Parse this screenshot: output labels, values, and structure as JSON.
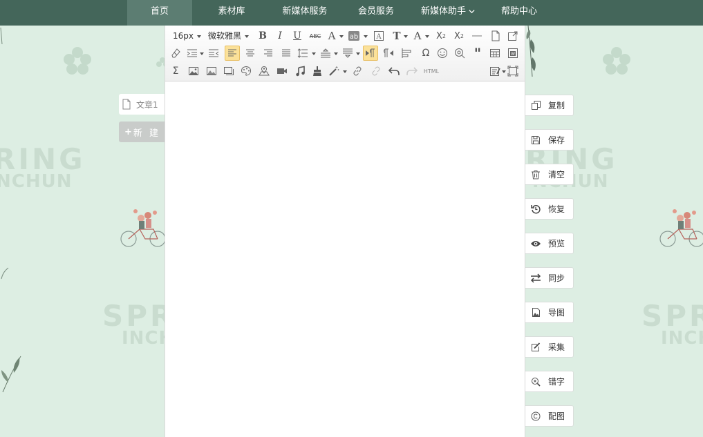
{
  "nav": {
    "items": [
      {
        "label": "首页",
        "active": true
      },
      {
        "label": "素材库"
      },
      {
        "label": "新媒体服务"
      },
      {
        "label": "会员服务"
      },
      {
        "label": "新媒体助手"
      },
      {
        "label": "帮助中心"
      }
    ],
    "bg_color": "#44665a",
    "active_color": "#5c7d72"
  },
  "documents": {
    "tabs": [
      {
        "label": "文章1"
      }
    ],
    "new_button": "新 建"
  },
  "toolbar": {
    "font_size": "16px",
    "font_family": "微软雅黑",
    "html_label": "HTML"
  },
  "actions": [
    {
      "label": "复制",
      "icon": "copy-icon"
    },
    {
      "label": "保存",
      "icon": "save-icon"
    },
    {
      "label": "清空",
      "icon": "trash-icon"
    },
    {
      "label": "恢复",
      "icon": "restore-icon"
    },
    {
      "label": "预览",
      "icon": "eye-icon"
    },
    {
      "label": "同步",
      "icon": "sync-icon"
    },
    {
      "label": "导图",
      "icon": "image-export-icon"
    },
    {
      "label": "采集",
      "icon": "collect-icon"
    },
    {
      "label": "错字",
      "icon": "typo-check-icon"
    },
    {
      "label": "配图",
      "icon": "copyright-icon"
    }
  ],
  "background": {
    "word_top": "RING",
    "word_top_sub": "NCHUN",
    "word_bottom": "SPRI",
    "word_bottom_sub": "INCHU",
    "word_top_right": "RING",
    "word_top_right_sub": "NCHUN",
    "word_bottom_right": "SPRI",
    "word_bottom_right_sub": "INCHU",
    "color": "#ddeee3"
  }
}
